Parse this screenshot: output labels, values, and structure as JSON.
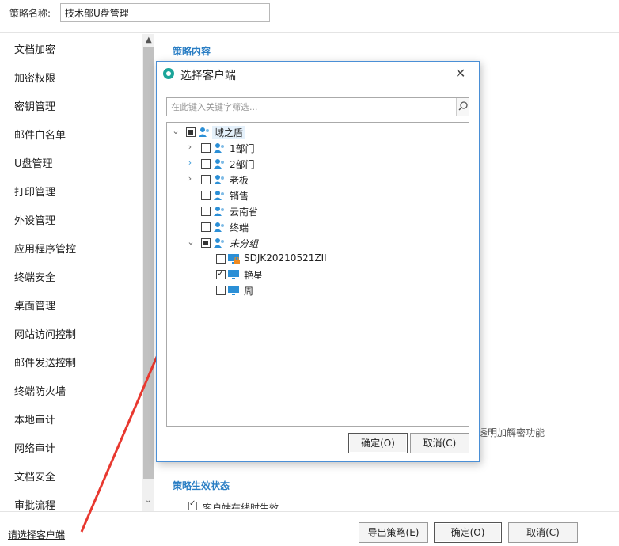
{
  "header": {
    "policy_name_label": "策略名称:",
    "policy_name_value": "技术部U盘管理"
  },
  "sidebar": {
    "items": [
      {
        "label": "文档加密"
      },
      {
        "label": "加密权限"
      },
      {
        "label": "密钥管理"
      },
      {
        "label": "邮件白名单"
      },
      {
        "label": "U盘管理"
      },
      {
        "label": "打印管理"
      },
      {
        "label": "外设管理"
      },
      {
        "label": "应用程序管控"
      },
      {
        "label": "终端安全"
      },
      {
        "label": "桌面管理"
      },
      {
        "label": "网站访问控制"
      },
      {
        "label": "邮件发送控制"
      },
      {
        "label": "终端防火墙"
      },
      {
        "label": "本地审计"
      },
      {
        "label": "网络审计"
      },
      {
        "label": "文档安全"
      },
      {
        "label": "审批流程"
      }
    ]
  },
  "content": {
    "section_title": "策略内容",
    "partial_text": "透明加解密功能",
    "status_title": "策略生效状态",
    "status_option_partial": "客户端在线时生效"
  },
  "dialog": {
    "title": "选择客户端",
    "search_placeholder": "在此键入关键字筛选...",
    "ok_label": "确定(O)",
    "cancel_label": "取消(C)",
    "tree": {
      "root": {
        "label": "域之盾",
        "state": "partial",
        "expanded": true
      },
      "groups": [
        {
          "label": "1部门",
          "state": "unchecked",
          "expandable": true
        },
        {
          "label": "2部门",
          "state": "unchecked",
          "expandable": true
        },
        {
          "label": "老板",
          "state": "unchecked",
          "expandable": true
        },
        {
          "label": "销售",
          "state": "unchecked",
          "expandable": false
        },
        {
          "label": "云南省",
          "state": "unchecked",
          "expandable": false
        },
        {
          "label": "终端",
          "state": "unchecked",
          "expandable": false
        }
      ],
      "ungrouped": {
        "label": "未分组",
        "state": "partial",
        "expanded": true,
        "clients": [
          {
            "label": "SDJK20210521ZII",
            "state": "unchecked",
            "locked": true
          },
          {
            "label": "艳星",
            "state": "checked",
            "locked": false
          },
          {
            "label": "周",
            "state": "unchecked",
            "locked": false
          }
        ]
      }
    }
  },
  "footer": {
    "select_client_link": "请选择客户端",
    "export_label": "导出策略(E)",
    "ok_label": "确定(O)",
    "cancel_label": "取消(C)"
  },
  "colors": {
    "accent_blue": "#2a7ec4",
    "user_icon_blue": "#2b8fd6",
    "dialog_border": "#4a8fd6",
    "arrow_red": "#e8382f",
    "lock_orange": "#f08a1e"
  },
  "icons": [
    "user-group-icon",
    "computer-icon",
    "lock-icon",
    "search-icon",
    "close-icon",
    "chevron-right-icon",
    "chevron-down-icon",
    "app-logo-icon"
  ]
}
